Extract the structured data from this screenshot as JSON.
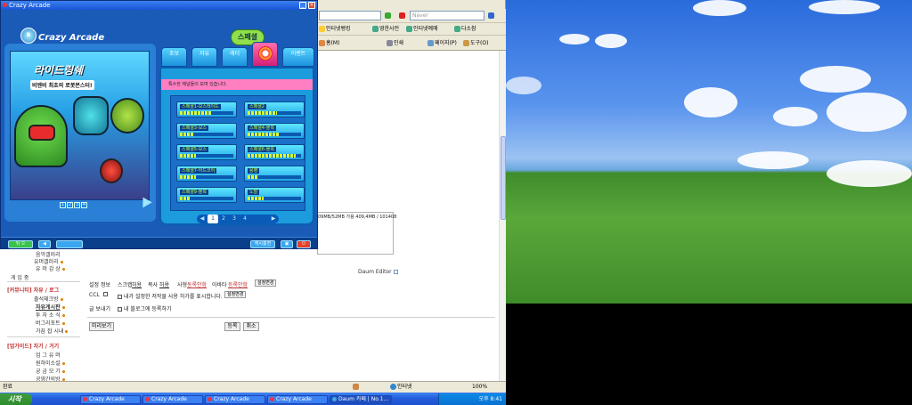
{
  "game": {
    "window_title": "Crazy Arcade",
    "logo_label": "Crazy Arcade",
    "banner": {
      "title": "라이드링쉐",
      "subtitle": "비엔비 최초의 로봇몬스터!",
      "pages": [
        "1",
        "2",
        "3",
        "4"
      ]
    },
    "tabs": [
      "초보",
      "자유",
      "레더",
      "",
      "이벤트"
    ],
    "active_tab_badge": "스페셜",
    "notice": "특수한 채널들이 모여 있습니다.",
    "channels": [
      {
        "name": "스페셜1-보스레이드",
        "fill": 0.6
      },
      {
        "name": "스페셜2",
        "fill": 0.55
      },
      {
        "name": "스페셜3-보스",
        "fill": 0.25
      },
      {
        "name": "스페셜4-블록",
        "fill": 0.6
      },
      {
        "name": "스페셜5-보스",
        "fill": 0.3
      },
      {
        "name": "스페셜6-블록",
        "fill": 0.9
      },
      {
        "name": "스페셜7-하드코어",
        "fill": 0.3
      },
      {
        "name": "용병",
        "fill": 0.2
      },
      {
        "name": "스페셜9-블록",
        "fill": 0.2
      },
      {
        "name": "노말",
        "fill": 0.3
      }
    ],
    "pager": [
      "1",
      "2",
      "3",
      "4"
    ],
    "footer": {
      "left_btn": "뒤 으",
      "right_text": "캐시충전"
    }
  },
  "browser": {
    "search_placeholder": "Naver",
    "links": [
      "인터넷뱅킹",
      "영한사전",
      "인터넷예매",
      "다소참"
    ],
    "toolbar": [
      "홈(M)",
      "인쇄",
      "페이지(P)",
      "도구(O)"
    ],
    "storage_text": "09MB/52MB 가용 409,4MB / 101408",
    "editor_brand": "Daum Editor",
    "status_left": "완료",
    "status_zone": "인터넷",
    "zoom": "100%"
  },
  "form": {
    "setting_label": "설정 정보",
    "scrap_label": "스크랩",
    "scrap_val": "허용",
    "copy_label": "복사",
    "copy_val": "허용",
    "tag_label": "사형",
    "tag_link": "동록안함",
    "avatar_label": "아바타",
    "avatar_link": "등록안함",
    "setting_btn": "설정변경",
    "ccl_label": "CCL",
    "ccl_text": "내가 설정한 저작물 사용 허가를 표시합니다.",
    "ccl_btn": "설정변경",
    "sign_label": "글 보내기",
    "sign_text": "내 블로그에 등록하기",
    "preview_btn": "미리보기",
    "submit_btn": "등록",
    "cancel_btn": "취소"
  },
  "sidebar": {
    "items": [
      {
        "text": "음악갤러리",
        "dot": false
      },
      {
        "text": "유머갤러리",
        "dot": true
      },
      {
        "text": "유 머 감 상",
        "dot": true
      },
      {
        "text": "게 임 중",
        "dot": false
      }
    ],
    "section1": "[커뮤니티] 자유 / 로그",
    "section1_items": [
      {
        "text": "출석체크방",
        "dot": true
      },
      {
        "text": "자유게시판",
        "dot": true
      },
      {
        "text": "투 자 소 식",
        "dot": true
      },
      {
        "text": "버그리포트",
        "dot": true
      },
      {
        "text": "가끔 잡 시내",
        "dot": true
      }
    ],
    "section2": "[업가이드] 자기 / 거기",
    "section2_items": [
      {
        "text": "업 그 유 머",
        "dot": false
      },
      {
        "text": "원하미소설",
        "dot": true
      },
      {
        "text": "궁 금 모 기",
        "dot": true
      },
      {
        "text": "공영간의방",
        "dot": true
      }
    ]
  },
  "taskbar": {
    "start": "시작",
    "tasks": [
      "Crazy Arcade",
      "Crazy Arcade",
      "Crazy Arcade",
      "Crazy Arcade",
      "Daum 카페 | No.1..."
    ],
    "clock": "오후 8:41"
  },
  "colors": {
    "accent": "#1c9bdd",
    "active_tab": "#d31f78",
    "taskbar": "#245edb"
  }
}
